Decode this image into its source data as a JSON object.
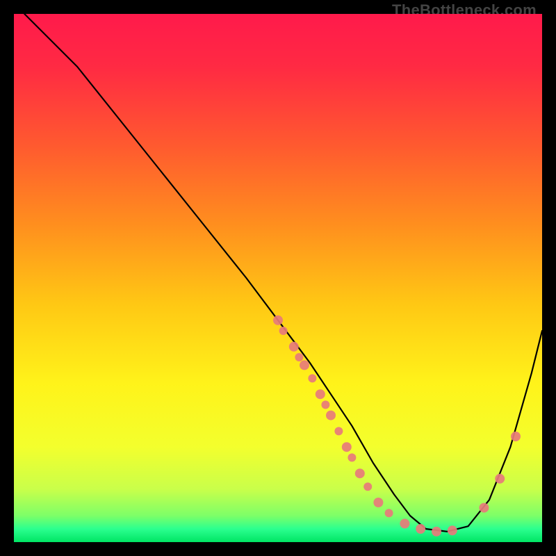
{
  "watermark": "TheBottleneck.com",
  "chart_data": {
    "type": "line",
    "title": "",
    "xlabel": "",
    "ylabel": "",
    "xlim": [
      0,
      100
    ],
    "ylim": [
      0,
      100
    ],
    "gradient_stops": [
      {
        "offset": 0.0,
        "color": "#ff1a4b"
      },
      {
        "offset": 0.1,
        "color": "#ff2a43"
      },
      {
        "offset": 0.25,
        "color": "#ff5a2f"
      },
      {
        "offset": 0.4,
        "color": "#ff8f1e"
      },
      {
        "offset": 0.55,
        "color": "#ffc814"
      },
      {
        "offset": 0.7,
        "color": "#fff31a"
      },
      {
        "offset": 0.82,
        "color": "#f3ff2d"
      },
      {
        "offset": 0.9,
        "color": "#c9ff4a"
      },
      {
        "offset": 0.95,
        "color": "#7dff68"
      },
      {
        "offset": 0.975,
        "color": "#2bff8f"
      },
      {
        "offset": 1.0,
        "color": "#00e564"
      }
    ],
    "series": [
      {
        "name": "curve",
        "x": [
          2,
          6,
          12,
          20,
          28,
          36,
          44,
          50,
          56,
          60,
          64,
          68,
          72,
          75,
          78,
          82,
          86,
          90,
          94,
          98,
          100
        ],
        "y": [
          100,
          96,
          90,
          80,
          70,
          60,
          50,
          42,
          34,
          28,
          22,
          15,
          9,
          5,
          2.5,
          2,
          3,
          8,
          18,
          32,
          40
        ]
      }
    ],
    "points": {
      "name": "markers",
      "color": "#e77b7b",
      "items": [
        {
          "x": 50,
          "y": 42,
          "r": 7
        },
        {
          "x": 51,
          "y": 40,
          "r": 6
        },
        {
          "x": 53,
          "y": 37,
          "r": 7
        },
        {
          "x": 54,
          "y": 35,
          "r": 6
        },
        {
          "x": 55,
          "y": 33.5,
          "r": 7
        },
        {
          "x": 56.5,
          "y": 31,
          "r": 6
        },
        {
          "x": 58,
          "y": 28,
          "r": 7
        },
        {
          "x": 59,
          "y": 26,
          "r": 6
        },
        {
          "x": 60,
          "y": 24,
          "r": 7
        },
        {
          "x": 61.5,
          "y": 21,
          "r": 6
        },
        {
          "x": 63,
          "y": 18,
          "r": 7
        },
        {
          "x": 64,
          "y": 16,
          "r": 6
        },
        {
          "x": 65.5,
          "y": 13,
          "r": 7
        },
        {
          "x": 67,
          "y": 10.5,
          "r": 6
        },
        {
          "x": 69,
          "y": 7.5,
          "r": 7
        },
        {
          "x": 71,
          "y": 5.5,
          "r": 6
        },
        {
          "x": 74,
          "y": 3.5,
          "r": 7
        },
        {
          "x": 77,
          "y": 2.5,
          "r": 7
        },
        {
          "x": 80,
          "y": 2.0,
          "r": 7
        },
        {
          "x": 83,
          "y": 2.2,
          "r": 7
        },
        {
          "x": 89,
          "y": 6.5,
          "r": 7
        },
        {
          "x": 92,
          "y": 12,
          "r": 7
        },
        {
          "x": 95,
          "y": 20,
          "r": 7
        }
      ]
    }
  }
}
